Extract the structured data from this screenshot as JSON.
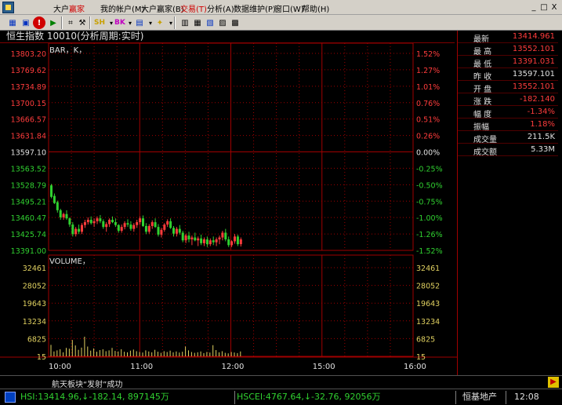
{
  "app": {
    "title_a": "大户",
    "title_b": "赢家"
  },
  "menu": [
    "我的帐户(M)",
    "大户赢家(B)",
    "交易(T)",
    "分析(A)",
    "数据维护(P)",
    "窗口(W)",
    "帮助(H)"
  ],
  "window_buttons": [
    "_",
    "□",
    "X"
  ],
  "toolbar": {
    "sh_label": "SH",
    "blk_label": "BK"
  },
  "chart_header": "恒生指数 10010(分析周期:实时)",
  "bar_label": "BAR，K，",
  "volume_label": "VOLUME，",
  "colors": {
    "up": "#ff3c3c",
    "down": "#30d030",
    "grid": "#a00000",
    "bg": "#000000",
    "text_white": "#e0e0e0"
  },
  "chart_data": [
    {
      "type": "line",
      "title": "",
      "x": [
        "10:00",
        "11:00",
        "12:00",
        "15:00",
        "16:00"
      ],
      "yticks_left": [
        "13803.20",
        "13769.62",
        "13734.89",
        "13700.15",
        "13666.57",
        "13631.84",
        "13597.10",
        "13563.52",
        "13528.79",
        "13495.21",
        "13460.47",
        "13425.74",
        "13391.00"
      ],
      "yticks_right": [
        "1.52%",
        "1.27%",
        "1.01%",
        "0.76%",
        "0.51%",
        "0.26%",
        "0.00%",
        "-0.25%",
        "-0.50%",
        "-0.75%",
        "-1.00%",
        "-1.26%",
        "-1.52%"
      ],
      "ylim": [
        13391.0,
        13803.2
      ],
      "prev_close": 13597.1,
      "candles_ohlc": [
        [
          13527,
          13530,
          13500,
          13503
        ],
        [
          13505,
          13510,
          13488,
          13490
        ],
        [
          13492,
          13495,
          13470,
          13475
        ],
        [
          13475,
          13478,
          13455,
          13460
        ],
        [
          13460,
          13470,
          13455,
          13467
        ],
        [
          13467,
          13475,
          13455,
          13458
        ],
        [
          13458,
          13460,
          13440,
          13445
        ],
        [
          13445,
          13450,
          13420,
          13425
        ],
        [
          13425,
          13440,
          13420,
          13436
        ],
        [
          13436,
          13445,
          13425,
          13430
        ],
        [
          13430,
          13448,
          13425,
          13444
        ],
        [
          13444,
          13455,
          13438,
          13450
        ],
        [
          13450,
          13460,
          13445,
          13455
        ],
        [
          13455,
          13462,
          13445,
          13448
        ],
        [
          13448,
          13458,
          13440,
          13452
        ],
        [
          13452,
          13462,
          13446,
          13458
        ],
        [
          13458,
          13465,
          13448,
          13452
        ],
        [
          13452,
          13456,
          13436,
          13440
        ],
        [
          13440,
          13450,
          13430,
          13446
        ],
        [
          13446,
          13458,
          13440,
          13455
        ],
        [
          13455,
          13462,
          13448,
          13450
        ],
        [
          13450,
          13458,
          13440,
          13444
        ],
        [
          13444,
          13446,
          13428,
          13432
        ],
        [
          13432,
          13445,
          13428,
          13440
        ],
        [
          13440,
          13452,
          13435,
          13448
        ],
        [
          13448,
          13456,
          13440,
          13445
        ],
        [
          13445,
          13452,
          13432,
          13436
        ],
        [
          13436,
          13448,
          13430,
          13444
        ],
        [
          13444,
          13455,
          13438,
          13450
        ],
        [
          13450,
          13462,
          13445,
          13458
        ],
        [
          13458,
          13464,
          13440,
          13442
        ],
        [
          13442,
          13448,
          13425,
          13430
        ],
        [
          13430,
          13446,
          13426,
          13442
        ],
        [
          13442,
          13454,
          13436,
          13450
        ],
        [
          13450,
          13458,
          13438,
          13440
        ],
        [
          13440,
          13446,
          13420,
          13424
        ],
        [
          13424,
          13438,
          13418,
          13434
        ],
        [
          13434,
          13448,
          13430,
          13445
        ],
        [
          13445,
          13456,
          13440,
          13452
        ],
        [
          13452,
          13458,
          13436,
          13438
        ],
        [
          13438,
          13442,
          13420,
          13426
        ],
        [
          13426,
          13440,
          13420,
          13436
        ],
        [
          13436,
          13444,
          13424,
          13428
        ],
        [
          13428,
          13432,
          13408,
          13412
        ],
        [
          13412,
          13426,
          13406,
          13422
        ],
        [
          13422,
          13430,
          13408,
          13414
        ],
        [
          13414,
          13422,
          13402,
          13418
        ],
        [
          13418,
          13428,
          13410,
          13412
        ],
        [
          13412,
          13420,
          13400,
          13416
        ],
        [
          13416,
          13424,
          13402,
          13406
        ],
        [
          13406,
          13418,
          13400,
          13414
        ],
        [
          13414,
          13420,
          13398,
          13404
        ],
        [
          13404,
          13416,
          13400,
          13412
        ],
        [
          13412,
          13420,
          13402,
          13408
        ],
        [
          13408,
          13418,
          13400,
          13414
        ],
        [
          13414,
          13422,
          13404,
          13418
        ],
        [
          13418,
          13432,
          13412,
          13428
        ],
        [
          13428,
          13436,
          13410,
          13414
        ],
        [
          13414,
          13420,
          13398,
          13402
        ],
        [
          13402,
          13412,
          13398,
          13410
        ],
        [
          13410,
          13425,
          13405,
          13420
        ],
        [
          13420,
          13424,
          13400,
          13404
        ],
        [
          13404,
          13418,
          13399,
          13414
        ]
      ]
    },
    {
      "type": "bar",
      "title": "",
      "yticks_left": [
        "32461",
        "28052",
        "19643",
        "13234",
        "6825",
        "15"
      ],
      "yticks_right": [
        "32461",
        "28052",
        "19643",
        "13234",
        "6825",
        "15"
      ],
      "ylim": [
        15,
        32461
      ],
      "values": [
        4200,
        1800,
        2200,
        2600,
        1500,
        3100,
        2800,
        6000,
        4000,
        2400,
        3200,
        7200,
        3600,
        2100,
        2900,
        1700,
        2300,
        2600,
        1900,
        2200,
        3100,
        2000,
        1800,
        2600,
        1700,
        1500,
        2100,
        2500,
        1900,
        1600,
        1400,
        2200,
        1800,
        1500,
        2400,
        1700,
        1300,
        1900,
        1600,
        2100,
        1500,
        1800,
        1400,
        1700,
        3600,
        2200,
        1600,
        1300,
        1500,
        1800,
        1200,
        1600,
        1400,
        4100,
        2300,
        1500,
        1900,
        1300,
        1100,
        1600,
        1400,
        1200,
        1800
      ]
    }
  ],
  "quote": [
    {
      "label": "最新",
      "value": "13414.961",
      "tone": "red"
    },
    {
      "label": "最 高",
      "value": "13552.101",
      "tone": "red"
    },
    {
      "label": "最 低",
      "value": "13391.031",
      "tone": "red"
    },
    {
      "label": "昨 收",
      "value": "13597.101",
      "tone": "white"
    },
    {
      "label": "开 盘",
      "value": "13552.101",
      "tone": "red"
    },
    {
      "label": "涨 跌",
      "value": "-182.140",
      "tone": "red"
    },
    {
      "label": "幅 度",
      "value": "-1.34%",
      "tone": "red"
    },
    {
      "label": "振幅",
      "value": "1.18%",
      "tone": "red"
    },
    {
      "label": "成交量",
      "value": "211.5K",
      "tone": "white"
    },
    {
      "label": "成交额",
      "value": "5.33M",
      "tone": "white"
    }
  ],
  "status": {
    "message": "航天板块“发射”成功",
    "hsi": "HSI:13414.96,↓-182.14, 897145万",
    "hscei": "HSCEI:4767.64,↓-32.76, 92056万",
    "stock": "恒基地产",
    "clock": "12:08"
  }
}
